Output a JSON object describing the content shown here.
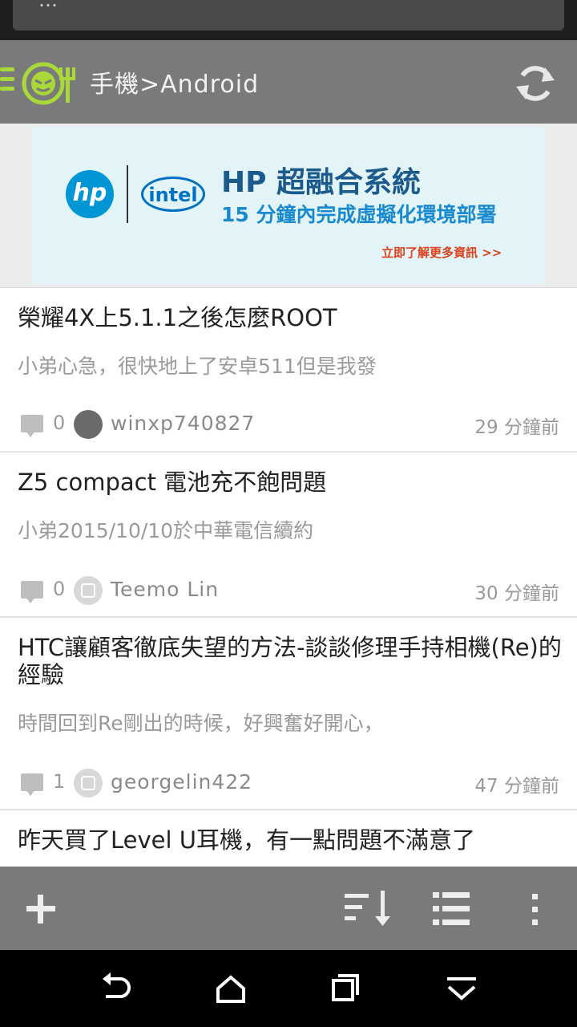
{
  "notification": {
    "text": "…"
  },
  "app_bar": {
    "menu_icon": "menu-lines-icon",
    "logo_icon": "app-logo-icon",
    "title": "手機>Android",
    "refresh_icon": "refresh-icon",
    "accent_color": "#a8d83a"
  },
  "ad": {
    "title": "HP 超融合系統",
    "subtitle": "15 分鐘內完成虛擬化環境部署",
    "cta": "立即了解更多資訊 >>",
    "brand_hp": "hp",
    "brand_intel": "intel"
  },
  "posts": [
    {
      "title": "榮耀4X上5.1.1之後怎麼ROOT",
      "excerpt": "小弟心急，很快地上了安卓511但是我發",
      "comments": "0",
      "author": "winxp740827",
      "time": "29 分鐘前",
      "avatar": "photo"
    },
    {
      "title": "Z5 compact 電池充不飽問題",
      "excerpt": "小弟2015/10/10於中華電信續約",
      "comments": "0",
      "author": "Teemo Lin",
      "time": "30 分鐘前",
      "avatar": "default"
    },
    {
      "title": "HTC讓顧客徹底失望的方法-談談修理手持相機(Re)的經驗",
      "excerpt": "時間回到Re剛出的時候，好興奮好開心，",
      "comments": "1",
      "author": "georgelin422",
      "time": "47 分鐘前",
      "avatar": "default"
    },
    {
      "title": "昨天買了Level U耳機，有一點問題不滿意了",
      "excerpt": "",
      "comments": "",
      "author": "",
      "time": "",
      "avatar": ""
    }
  ],
  "bottom_bar": {
    "add_icon": "plus-icon",
    "sort_icon": "sort-icon",
    "list_icon": "list-view-icon",
    "more_icon": "more-vert-icon"
  },
  "nav_bar": {
    "back_icon": "back-icon",
    "home_icon": "home-icon",
    "recents_icon": "recents-icon",
    "notifications_icon": "expand-down-icon"
  }
}
